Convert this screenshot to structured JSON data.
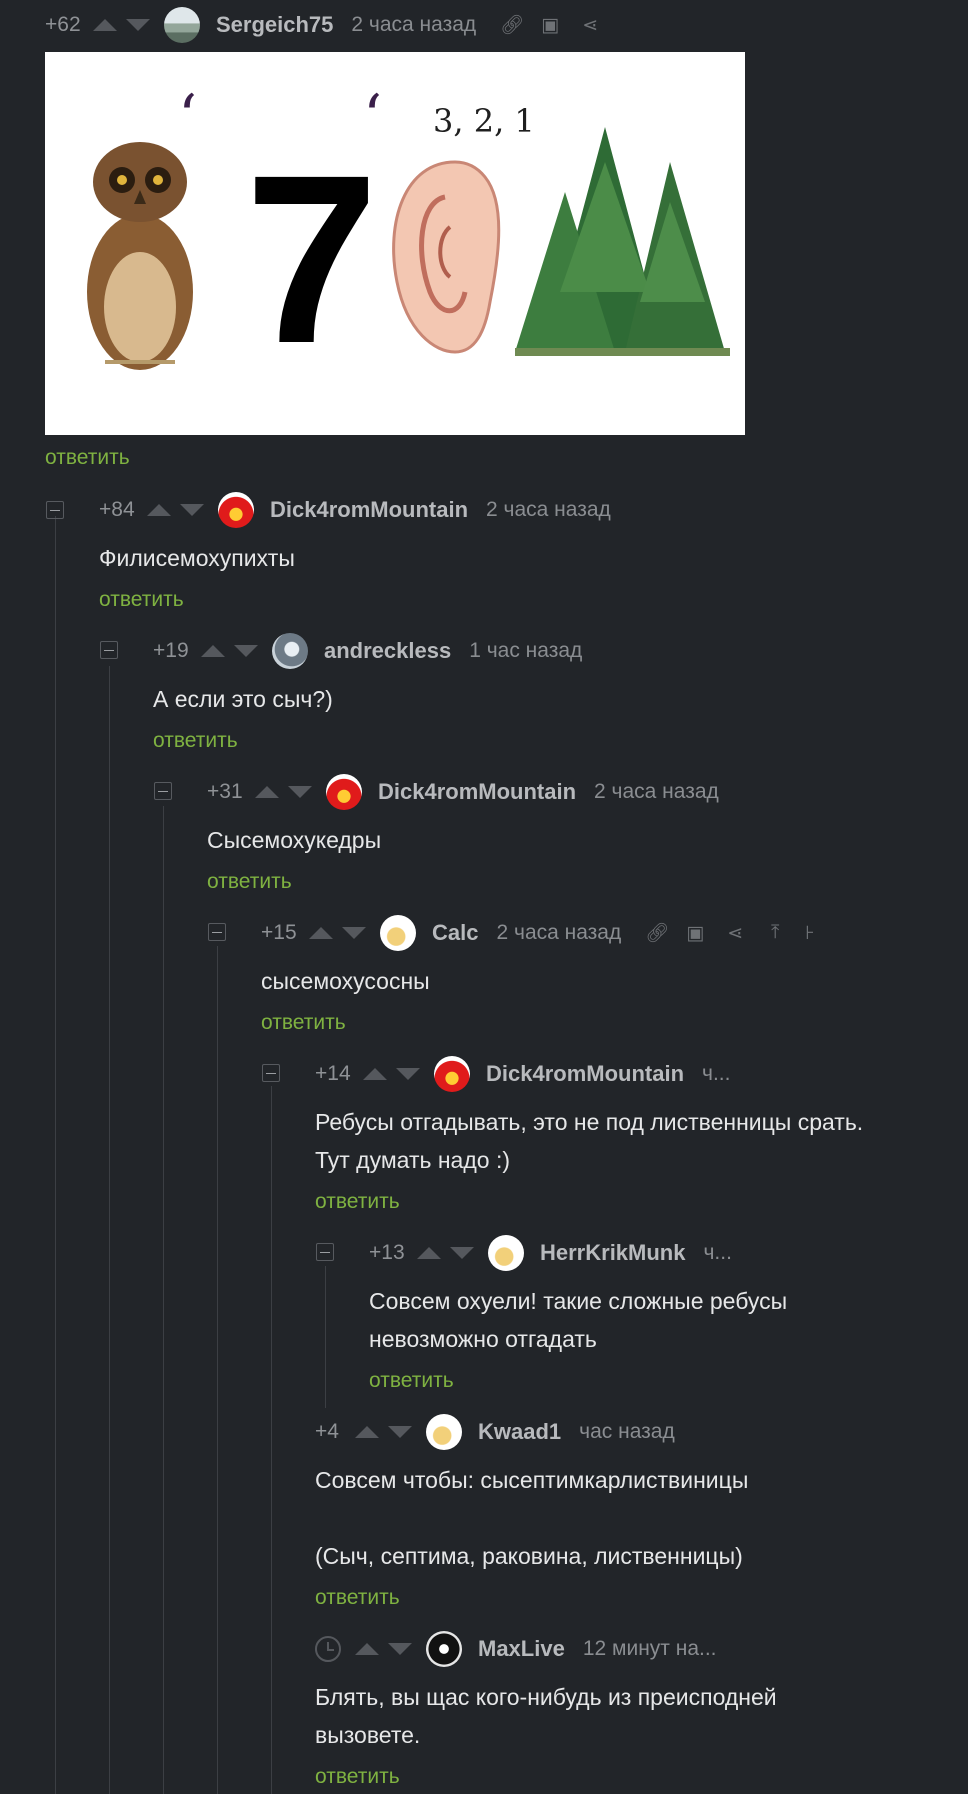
{
  "post": {
    "rating": "+62",
    "username": "Sergeich75",
    "time": "2 часа назад",
    "image": {
      "mark_left": "‘",
      "seven": "7",
      "mark_right": "‘",
      "countdown": "3, 2, 1"
    },
    "reply": "ответить"
  },
  "comments": [
    {
      "rating": "+84",
      "username": "Dick4romMountain",
      "time": "2 часа назад",
      "text": "Филисемохупихты",
      "reply": "ответить"
    },
    {
      "rating": "+19",
      "username": "andreckless",
      "time": "1 час назад",
      "text": "А если это сыч?)",
      "reply": "ответить"
    },
    {
      "rating": "+31",
      "username": "Dick4romMountain",
      "time": "2 часа назад",
      "text": "Сысемохукедры",
      "reply": "ответить"
    },
    {
      "rating": "+15",
      "username": "Calc",
      "time": "2 часа назад",
      "text": "сысемохусосны",
      "reply": "ответить"
    },
    {
      "rating": "+14",
      "username": "Dick4romMountain",
      "time": "ч...",
      "text_line1": "Ребусы отгадывать, это не под лиственницы срать.",
      "text_line2": "Тут думать надо :)",
      "reply": "ответить"
    },
    {
      "rating": "+13",
      "username": "HerrKrikMunk",
      "time": "ч...",
      "text_line1": "Совсем охуели! такие сложные ребусы",
      "text_line2": "невозможно отгадать",
      "reply": "ответить"
    },
    {
      "rating": "+4",
      "username": "Kwaad1",
      "time": "час назад",
      "text_line1": "Совсем чтобы: сысептимкарлиствиницы",
      "text_line2": "(Сыч, септима, раковина, лиственницы)",
      "reply": "ответить"
    },
    {
      "username": "MaxLive",
      "time": "12 минут на...",
      "text_line1": "Блять, вы щас кого-нибудь из преисподней",
      "text_line2": "вызовете.",
      "reply": "ответить"
    }
  ]
}
